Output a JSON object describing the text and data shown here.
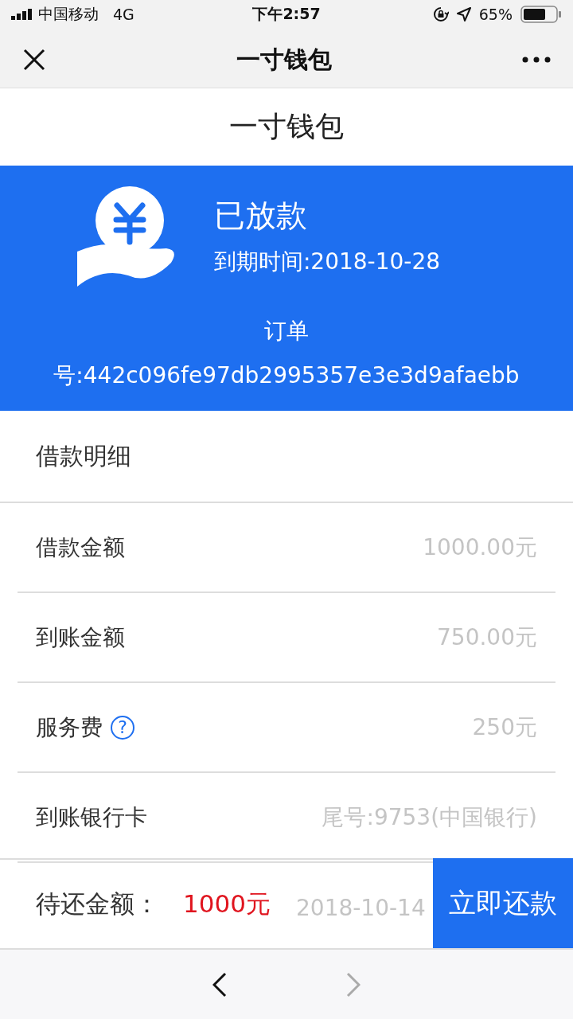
{
  "status_bar": {
    "carrier": "中国移动",
    "network": "4G",
    "time": "下午2:57",
    "battery": "65%"
  },
  "nav_bar": {
    "title": "一寸钱包"
  },
  "page_title": "一寸钱包",
  "banner": {
    "status": "已放款",
    "due_date": "到期时间:2018-10-28",
    "order": "订单号:442c096fe97db2995357e3e3d9afaebb"
  },
  "details": {
    "title": "借款明细",
    "rows": [
      {
        "label": "借款金额",
        "value": "1000.00元"
      },
      {
        "label": "到账金额",
        "value": "750.00元"
      },
      {
        "label": "服务费",
        "value": "250元",
        "help": "?"
      },
      {
        "label": "到账银行卡",
        "value": "尾号:9753(中国银行)"
      },
      {
        "value": "2018-10-14"
      }
    ]
  },
  "pay_bar": {
    "label": "待还金额：",
    "amount": "1000元",
    "button": "立即还款"
  },
  "browser_toolbar": {
    "back_disabled": false,
    "forward_disabled": true
  }
}
